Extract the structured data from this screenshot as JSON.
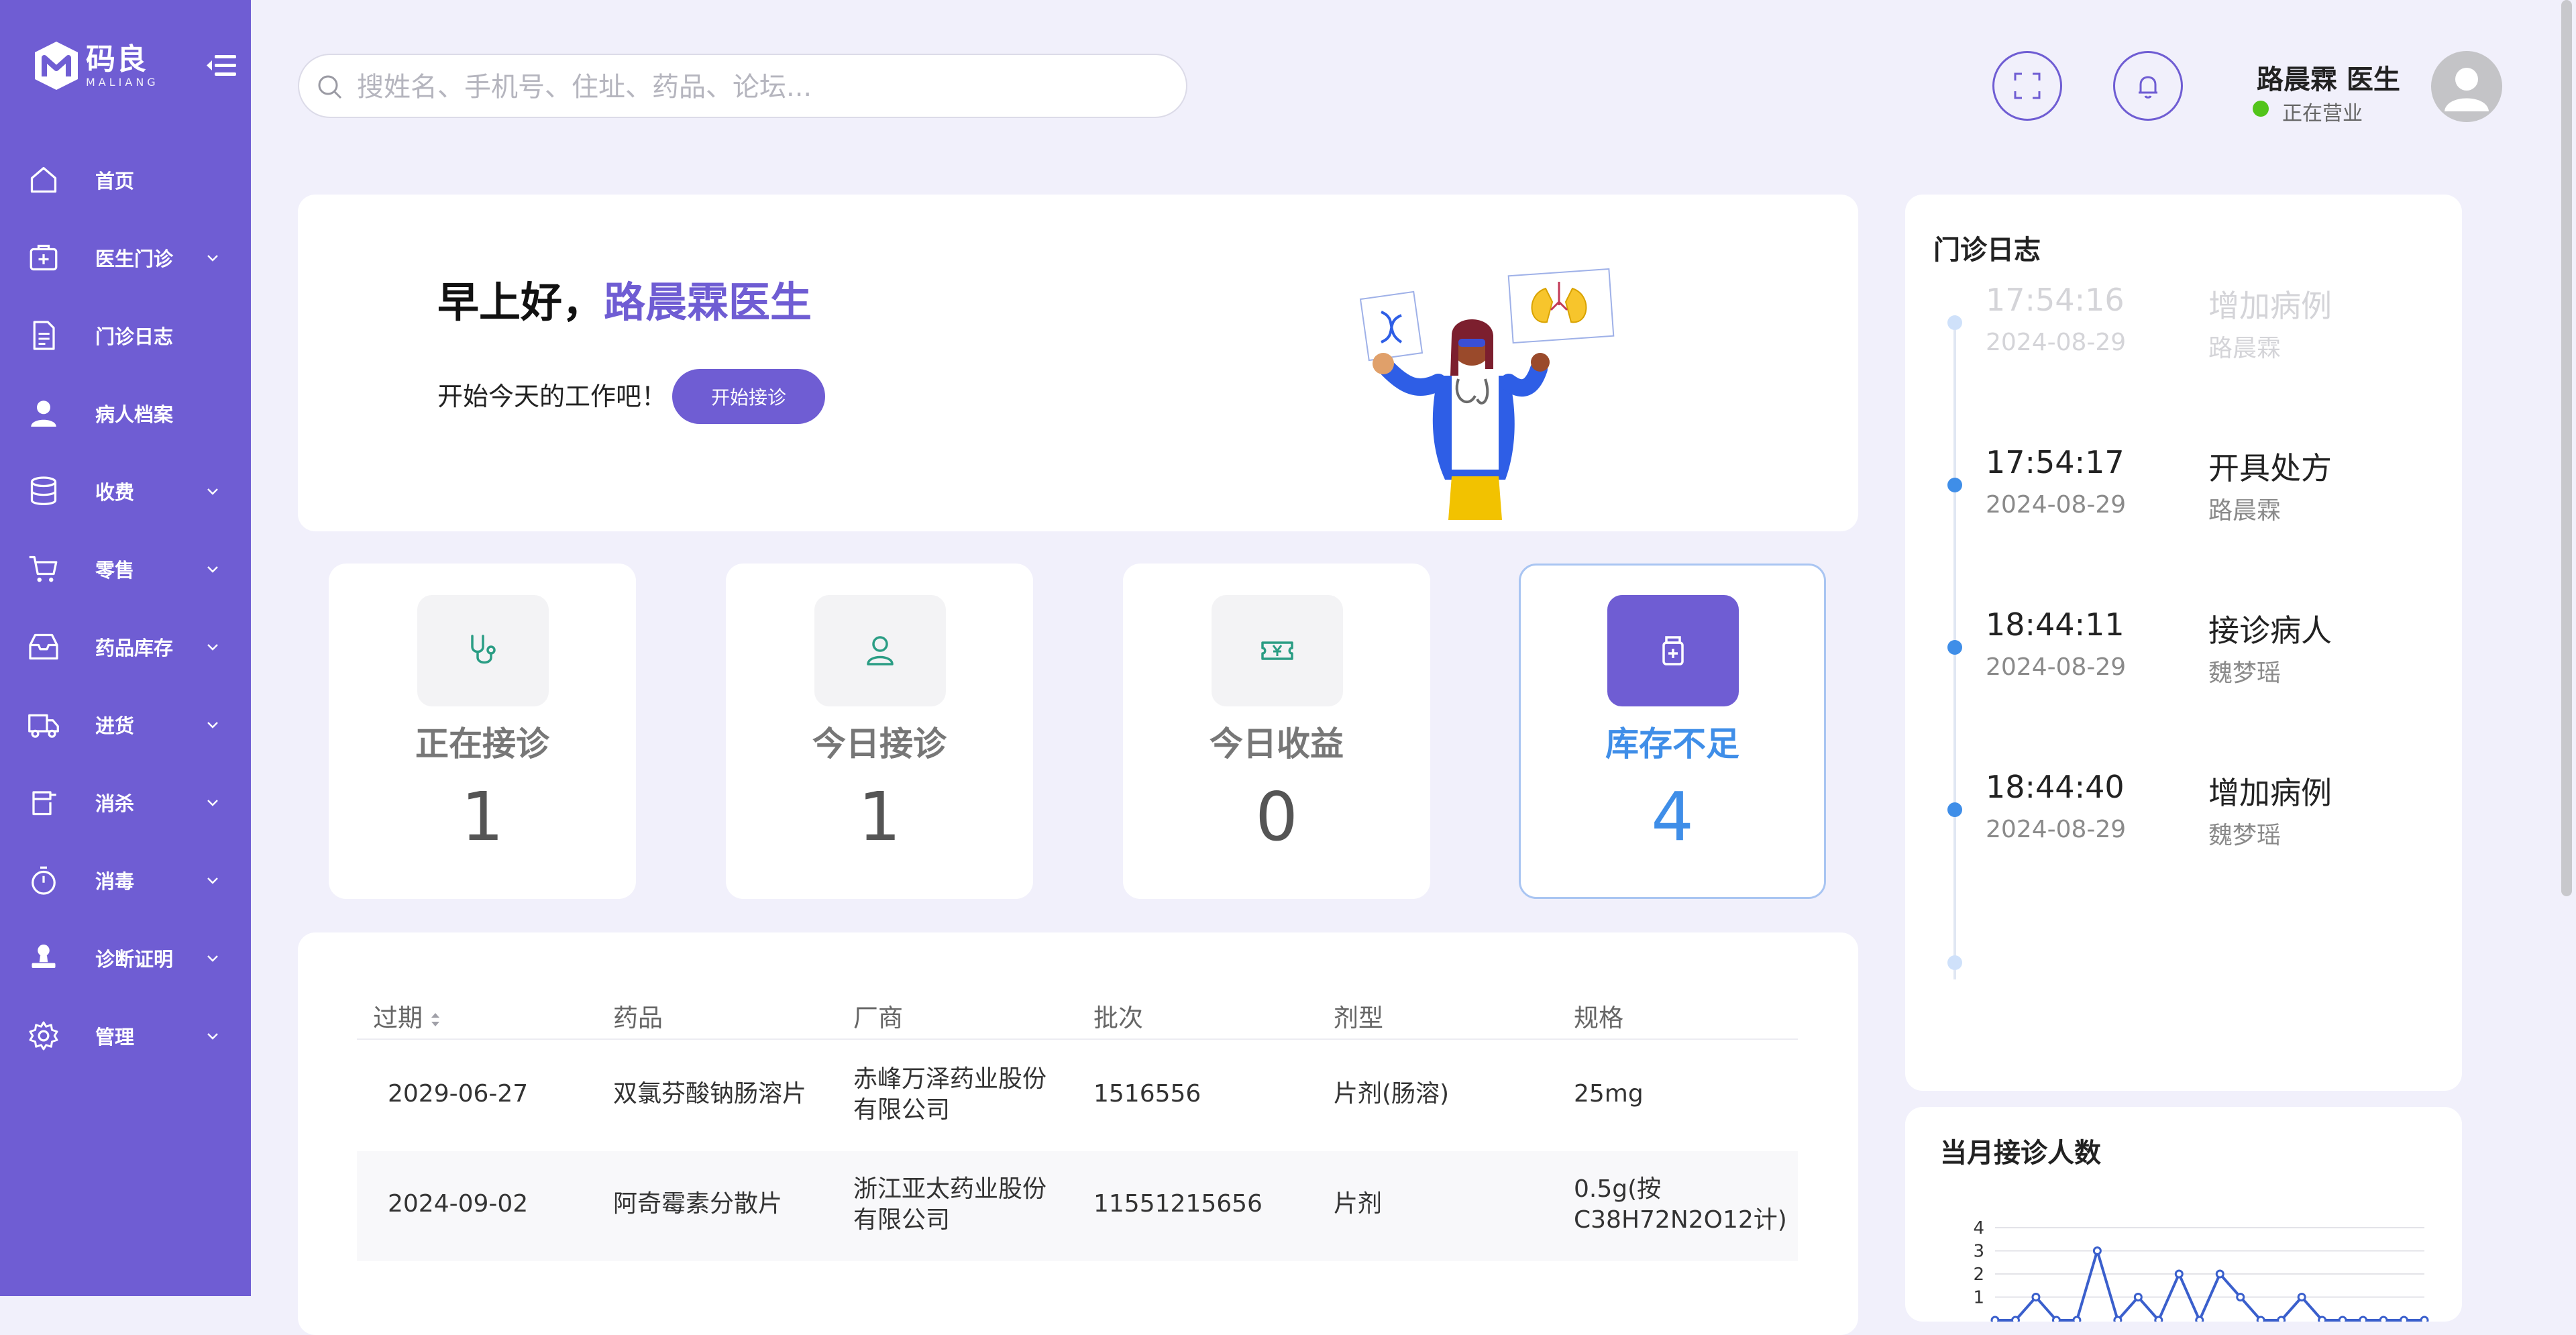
{
  "brand": {
    "name_cn": "码良",
    "name_en": "MALIANG"
  },
  "sidebar": {
    "items": [
      {
        "label": "首页",
        "icon": "home-icon",
        "has_children": false
      },
      {
        "label": "医生门诊",
        "icon": "clinic-plus-icon",
        "has_children": true
      },
      {
        "label": "门诊日志",
        "icon": "document-icon",
        "has_children": false
      },
      {
        "label": "病人档案",
        "icon": "user-icon",
        "has_children": false
      },
      {
        "label": "收费",
        "icon": "database-icon",
        "has_children": true
      },
      {
        "label": "零售",
        "icon": "cart-icon",
        "has_children": true
      },
      {
        "label": "药品库存",
        "icon": "inventory-box-icon",
        "has_children": true
      },
      {
        "label": "进货",
        "icon": "truck-icon",
        "has_children": true
      },
      {
        "label": "消杀",
        "icon": "sprayer-icon",
        "has_children": true
      },
      {
        "label": "消毒",
        "icon": "stopwatch-icon",
        "has_children": true
      },
      {
        "label": "诊断证明",
        "icon": "stamp-icon",
        "has_children": true
      },
      {
        "label": "管理",
        "icon": "gear-icon",
        "has_children": true
      }
    ]
  },
  "header": {
    "search_placeholder": "搜姓名、手机号、住址、药品、论坛...",
    "user_name": "路晨霖 医生",
    "user_status": "正在营业",
    "status_color": "#52c41a"
  },
  "welcome": {
    "greeting": "早上好，",
    "doctor_name": "路晨霖医生",
    "subtitle": "开始今天的工作吧！",
    "start_button": "开始接诊"
  },
  "stats": [
    {
      "label": "正在接诊",
      "value": "1",
      "icon": "stethoscope-icon",
      "active": false
    },
    {
      "label": "今日接诊",
      "value": "1",
      "icon": "patient-icon",
      "active": false
    },
    {
      "label": "今日收益",
      "value": "0",
      "icon": "ticket-yuan-icon",
      "active": false
    },
    {
      "label": "库存不足",
      "value": "4",
      "icon": "medicine-bottle-icon",
      "active": true
    }
  ],
  "table": {
    "columns": [
      "过期",
      "药品",
      "厂商",
      "批次",
      "剂型",
      "规格"
    ],
    "rows": [
      {
        "expiry": "2029-06-27",
        "drug": "双氯芬酸钠肠溶片",
        "maker_line1": "赤峰万泽药业股份",
        "maker_line2": "有限公司",
        "batch": "1516556",
        "form": "片剂(肠溶)",
        "spec_line1": "25mg",
        "spec_line2": ""
      },
      {
        "expiry": "2024-09-02",
        "drug": "阿奇霉素分散片",
        "maker_line1": "浙江亚太药业股份",
        "maker_line2": "有限公司",
        "batch": "11551215656",
        "form": "片剂",
        "spec_line1": "0.5g(按",
        "spec_line2": "C38H72N2O12计)"
      }
    ]
  },
  "log": {
    "title": "门诊日志",
    "entries": [
      {
        "time": "17:54:16",
        "date": "2024-08-29",
        "action": "增加病例",
        "who": "路晨霖",
        "faded": true
      },
      {
        "time": "17:54:17",
        "date": "2024-08-29",
        "action": "开具处方",
        "who": "路晨霖",
        "faded": false
      },
      {
        "time": "18:44:11",
        "date": "2024-08-29",
        "action": "接诊病人",
        "who": "魏梦瑶",
        "faded": false
      },
      {
        "time": "18:44:40",
        "date": "2024-08-29",
        "action": "增加病例",
        "who": "魏梦瑶",
        "faded": false
      }
    ]
  },
  "monthly": {
    "title": "当月接诊人数"
  },
  "chart_data": {
    "type": "line",
    "title": "当月接诊人数",
    "y_ticks": [
      "4",
      "3",
      "2",
      "1"
    ],
    "ylim": [
      0,
      4
    ],
    "series": [
      {
        "values": [
          0,
          0,
          1,
          0,
          0,
          3,
          0,
          1,
          0,
          2,
          0,
          2,
          1,
          0,
          0,
          1,
          0,
          0,
          0,
          0,
          0,
          0
        ]
      }
    ],
    "color": "#3a5fcc",
    "grid": true
  }
}
